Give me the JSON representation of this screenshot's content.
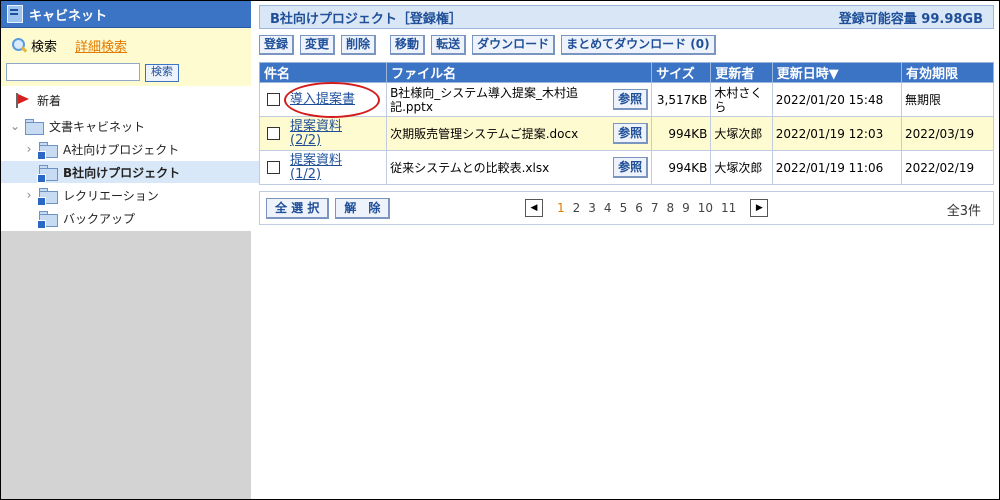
{
  "cabinet": {
    "title": "キャビネット"
  },
  "search": {
    "link": "検索",
    "advanced": "詳細検索",
    "button": "検索",
    "value": ""
  },
  "tree": {
    "new_items": "新着",
    "root": "文書キャビネット",
    "items": [
      "A社向けプロジェクト",
      "B社向けプロジェクト",
      "レクリエーション",
      "バックアップ"
    ]
  },
  "main": {
    "title": "B社向けプロジェクト［登録権］",
    "capacity": "登録可能容量 99.98GB"
  },
  "toolbar": {
    "register": "登録",
    "change": "変更",
    "delete": "削除",
    "move": "移動",
    "forward": "転送",
    "download": "ダウンロード",
    "bulk_download": "まとめてダウンロード (0)"
  },
  "table": {
    "headers": {
      "title": "件名",
      "filename": "ファイル名",
      "size": "サイズ",
      "updater": "更新者",
      "updated": "更新日時▼",
      "expiry": "有効期限"
    },
    "rows": [
      {
        "title": "導入提案書",
        "filename": "B社様向_システム導入提案_木村追記.pptx",
        "ref": "参照",
        "size": "3,517KB",
        "updater": "木村さくら",
        "updated": "2022/01/20 15:48",
        "expiry": "無期限"
      },
      {
        "title": "提案資料 (2/2)",
        "filename": "次期販売管理システムご提案.docx",
        "ref": "参照",
        "size": "994KB",
        "updater": "大塚次郎",
        "updated": "2022/01/19 12:03",
        "expiry": "2022/03/19"
      },
      {
        "title": "提案資料 (1/2)",
        "filename": "従来システムとの比較表.xlsx",
        "ref": "参照",
        "size": "994KB",
        "updater": "大塚次郎",
        "updated": "2022/01/19 11:06",
        "expiry": "2022/02/19"
      }
    ]
  },
  "footer": {
    "select_all": "全 選 択",
    "clear": "解　除",
    "pages": [
      "1",
      "2",
      "3",
      "4",
      "5",
      "6",
      "7",
      "8",
      "9",
      "10",
      "11"
    ],
    "current_page": "1",
    "total": "全3件"
  }
}
